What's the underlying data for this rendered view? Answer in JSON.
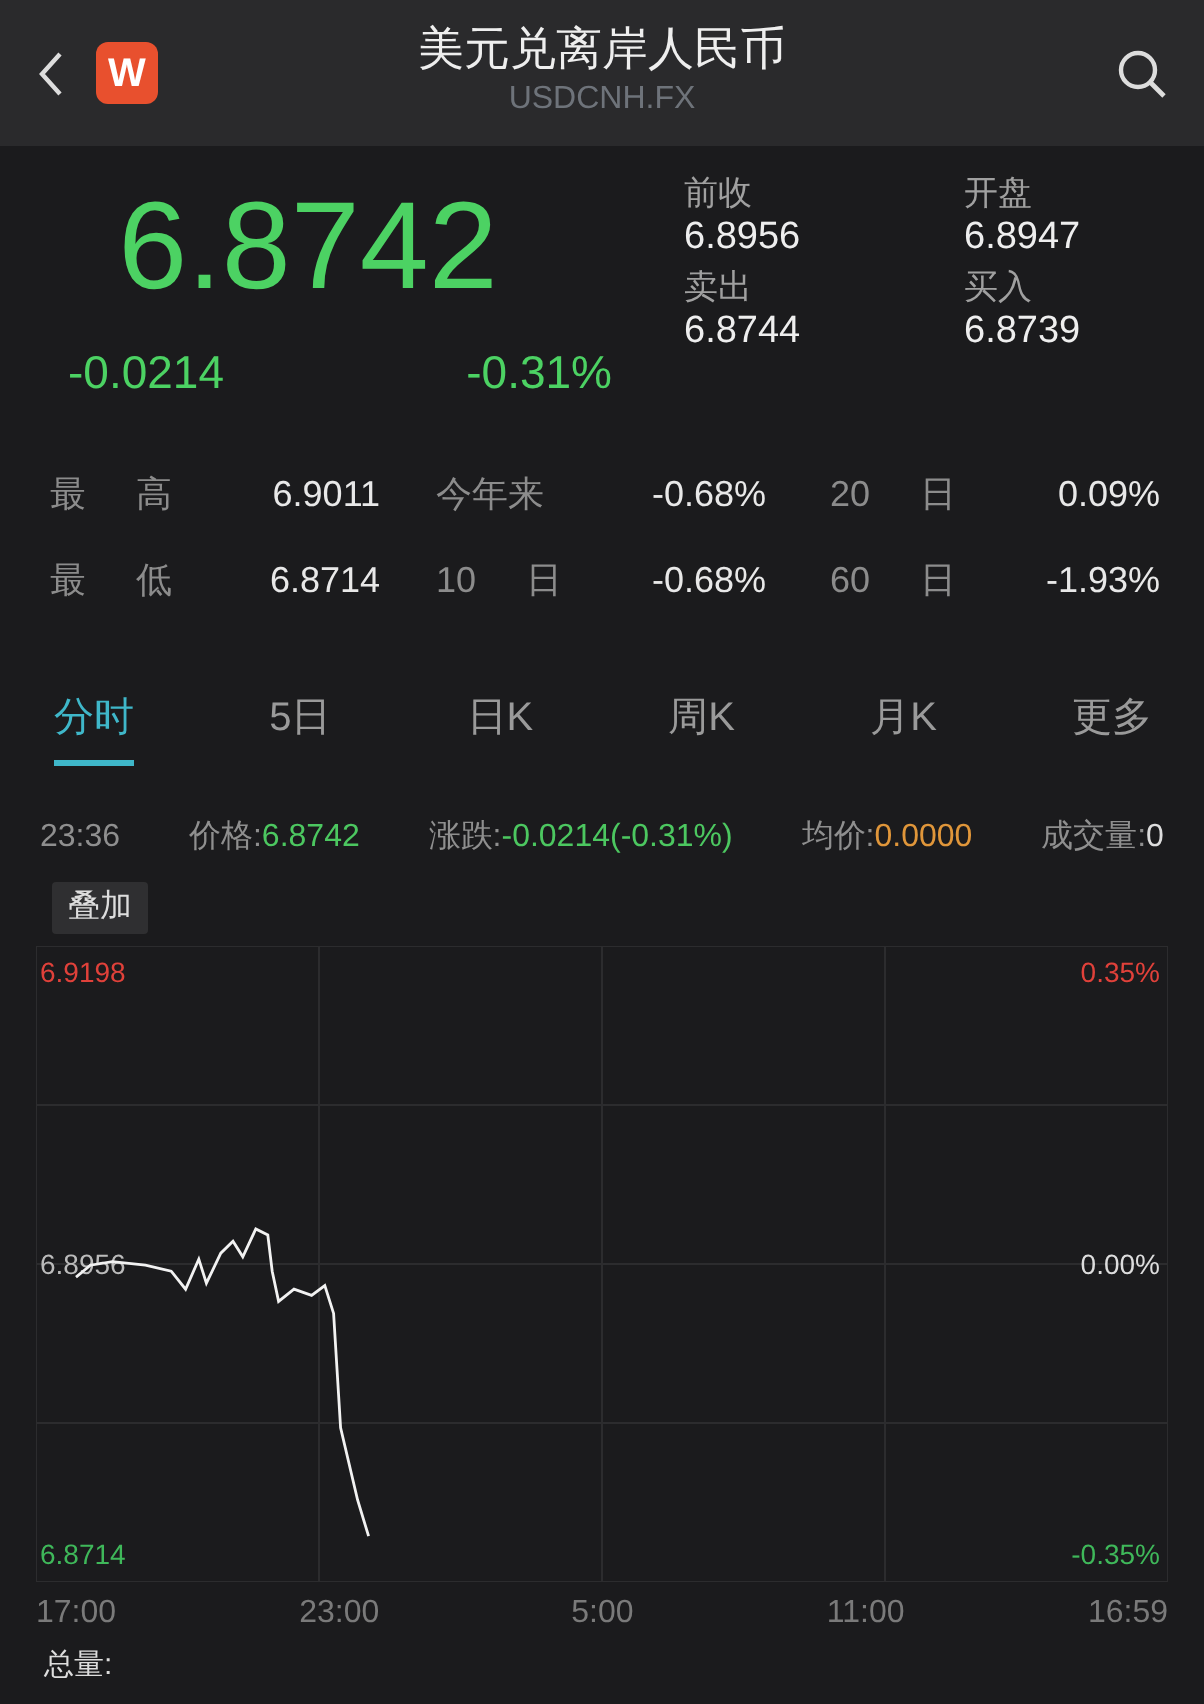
{
  "header": {
    "badge": "W",
    "title": "美元兑离岸人民币",
    "subtitle": "USDCNH.FX"
  },
  "quote": {
    "price": "6.8742",
    "change": "-0.0214",
    "change_pct": "-0.31%",
    "fields": [
      {
        "label": "前收",
        "value": "6.8956"
      },
      {
        "label": "开盘",
        "value": "6.8947"
      },
      {
        "label": "卖出",
        "value": "6.8744"
      },
      {
        "label": "买入",
        "value": "6.8739"
      }
    ]
  },
  "stats": [
    {
      "label": "最 高",
      "value": "6.9011"
    },
    {
      "label": "今年来",
      "value": "-0.68%"
    },
    {
      "label": "20 日",
      "value": "0.09%"
    },
    {
      "label": "最 低",
      "value": "6.8714"
    },
    {
      "label": "10 日",
      "value": "-0.68%"
    },
    {
      "label": "60 日",
      "value": "-1.93%"
    }
  ],
  "tabs": [
    {
      "label": "分时",
      "selected": true
    },
    {
      "label": "5日",
      "selected": false
    },
    {
      "label": "日K",
      "selected": false
    },
    {
      "label": "周K",
      "selected": false
    },
    {
      "label": "月K",
      "selected": false
    },
    {
      "label": "更多",
      "selected": false
    }
  ],
  "info": {
    "time": "23:36",
    "items": [
      {
        "label": "价格:",
        "value": "6.8742",
        "color": "#4cc760"
      },
      {
        "label": "涨跌:",
        "value": "-0.0214(-0.31%)",
        "color": "#4cc760"
      },
      {
        "label": "均价:",
        "value": "0.0000",
        "color": "#e0963a"
      },
      {
        "label": "成交量:",
        "value": "0",
        "color": "#dddddd"
      }
    ]
  },
  "chart": {
    "overlay_button": "叠加",
    "x_labels_next_day": [
      "5:00",
      "11:00",
      "16:59"
    ],
    "y_left": [
      {
        "color": "#e0413a"
      },
      {
        "color": "#bbbbbb"
      },
      {
        "color": "#3fb85a"
      }
    ],
    "y_right": [
      {
        "text": "0.35%",
        "color": "#e0413a"
      },
      {
        "text": "0.00%",
        "color": "#dddddd"
      },
      {
        "text": "-0.35%",
        "color": "#3fb85a"
      }
    ],
    "chart_data": {
      "type": "line",
      "x": [
        17.0,
        17.33,
        17.83,
        18.58,
        19.17,
        19.5,
        19.8,
        19.97,
        20.3,
        20.58,
        20.8,
        21.1,
        21.37,
        21.47,
        21.62,
        21.97,
        22.37,
        22.67,
        22.87,
        23.03,
        23.42,
        23.67
      ],
      "series": [
        {
          "color": "#f2f2f2",
          "values": [
            6.8945,
            6.8955,
            6.8958,
            6.8955,
            6.895,
            6.8935,
            6.896,
            6.894,
            6.8965,
            6.8975,
            6.8962,
            6.8985,
            6.898,
            6.895,
            6.8925,
            6.8935,
            6.893,
            6.8938,
            6.8915,
            6.882,
            6.876,
            6.873
          ]
        }
      ],
      "xlim": [
        16.088,
        41.892
      ],
      "ylim": [
        6.8692,
        6.922
      ],
      "xticks": [
        {
          "value": 17,
          "label": "17:00"
        },
        {
          "value": 23,
          "label": "23:00"
        }
      ],
      "yticks": [
        {
          "value": 6.9198,
          "label": "6.9198"
        },
        {
          "value": 6.8956,
          "label": "6.8956"
        },
        {
          "value": 6.8714,
          "label": "6.8714"
        }
      ]
    },
    "volume_label": "总量:"
  }
}
